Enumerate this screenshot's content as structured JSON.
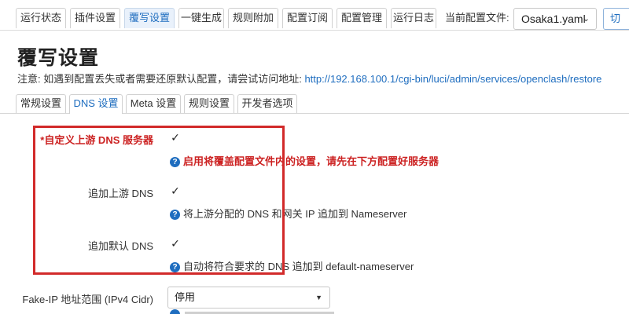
{
  "top_tabs": [
    {
      "label": "运行状态"
    },
    {
      "label": "插件设置"
    },
    {
      "label": "覆写设置",
      "active": true
    },
    {
      "label": "一键生成"
    },
    {
      "label": "规则附加"
    },
    {
      "label": "配置订阅"
    },
    {
      "label": "配置管理"
    },
    {
      "label": "运行日志"
    }
  ],
  "config": {
    "label": "当前配置文件:",
    "selected": "Osaka1.yaml",
    "edge_button": "切"
  },
  "page": {
    "title": "覆写设置",
    "notice_prefix": "注意: 如遇到配置丢失或者需要还原默认配置，请尝试访问地址: ",
    "notice_link": "http://192.168.100.1/cgi-bin/luci/admin/services/openclash/restore"
  },
  "sub_tabs": [
    {
      "label": "常规设置"
    },
    {
      "label": "DNS 设置",
      "active": true
    },
    {
      "label": "Meta 设置"
    },
    {
      "label": "规则设置"
    },
    {
      "label": "开发者选项"
    }
  ],
  "options": [
    {
      "label": "*自定义上游 DNS 服务器",
      "checked": "✓",
      "help": "启用将覆盖配置文件内的设置，请先在下方配置好服务器"
    },
    {
      "label": "追加上游 DNS",
      "checked": "✓",
      "help": "将上游分配的 DNS 和网关 IP 追加到 Nameserver"
    },
    {
      "label": "追加默认 DNS",
      "checked": "✓",
      "help": "自动将符合要求的 DNS 追加到 default-nameserver"
    }
  ],
  "fakeip": {
    "label": "Fake-IP 地址范围 (IPv4 Cidr)",
    "value": "停用"
  },
  "colors": {
    "accent": "#1e6dbf",
    "highlight": "#d22a2a",
    "warning_text": "#cc2222"
  }
}
